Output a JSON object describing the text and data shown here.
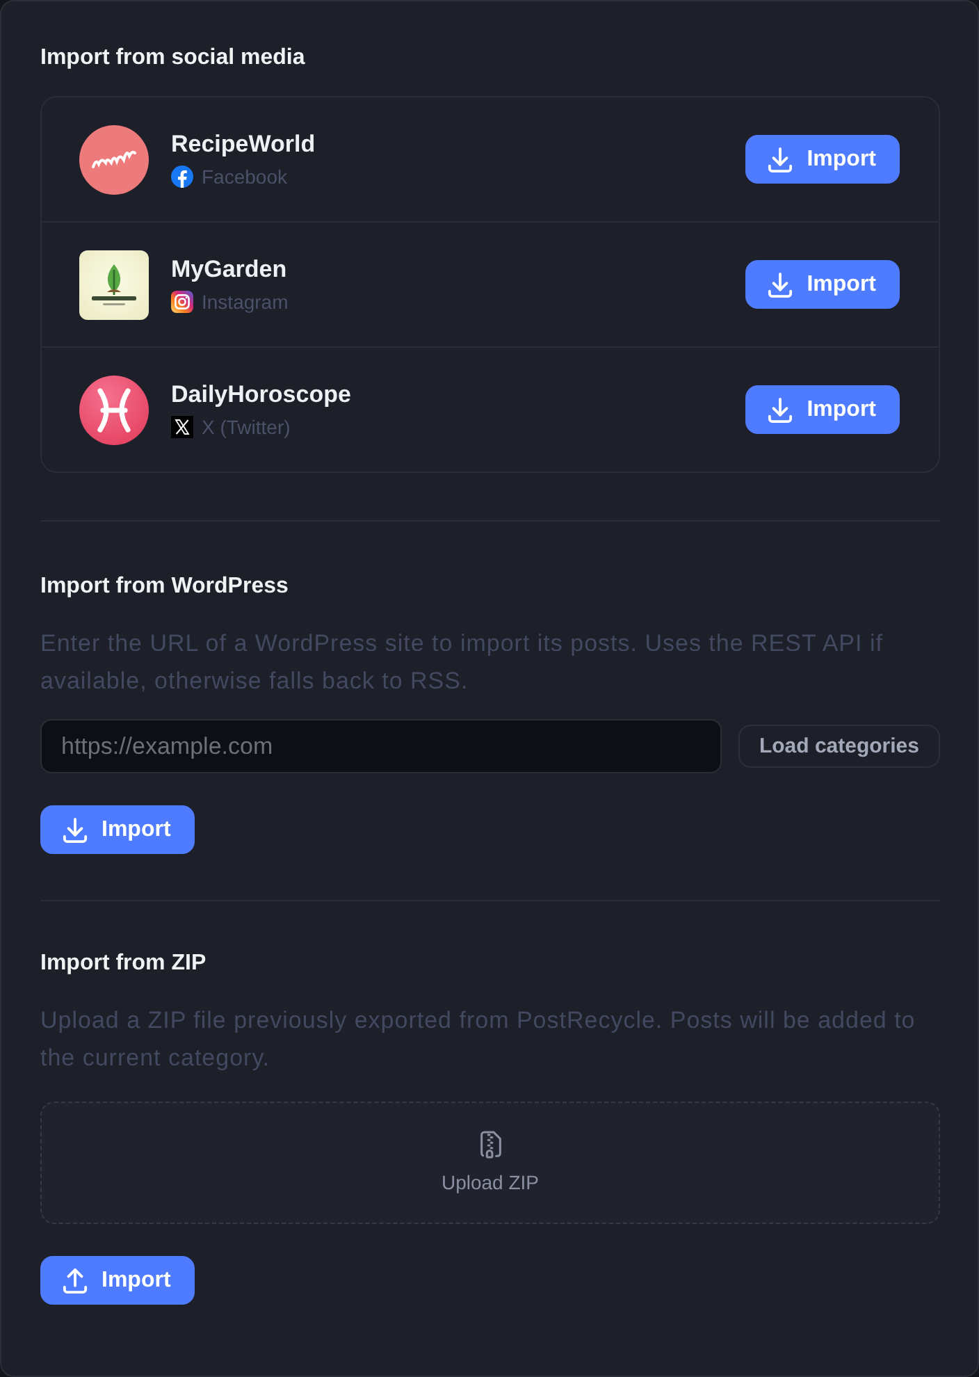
{
  "social": {
    "title": "Import from social media",
    "accounts": [
      {
        "name": "RecipeWorld",
        "avatar": {
          "kind": "script"
        },
        "network": {
          "kind": "facebook",
          "label": "Facebook"
        },
        "button": {
          "label": "Import",
          "kind": "download"
        }
      },
      {
        "name": "MyGarden",
        "avatar": {
          "kind": "tree"
        },
        "network": {
          "kind": "instagram",
          "label": "Instagram"
        },
        "button": {
          "label": "Import",
          "kind": "download"
        }
      },
      {
        "name": "DailyHoroscope",
        "avatar": {
          "kind": "pisces"
        },
        "network": {
          "kind": "x",
          "label": "X (Twitter)"
        },
        "button": {
          "label": "Import",
          "kind": "download"
        }
      }
    ]
  },
  "wordpress": {
    "title": "Import from WordPress",
    "description": "Enter the URL of a WordPress site to import its posts. Uses the REST API if available, otherwise falls back to RSS.",
    "url_field": {
      "placeholder": "https://example.com"
    },
    "load_button": "Load categories",
    "import_button": {
      "label": "Import",
      "kind": "download"
    }
  },
  "zip": {
    "title": "Import from ZIP",
    "description": "Upload a ZIP file previously exported from PostRecycle. Posts will be added to the current category.",
    "dropzone": {
      "label": "Upload ZIP"
    },
    "import_button": {
      "label": "Import",
      "kind": "upload"
    }
  }
}
